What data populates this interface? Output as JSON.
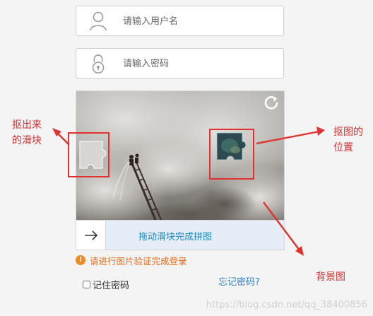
{
  "login": {
    "username_placeholder": "请输入用户名",
    "password_placeholder": "请输入密码"
  },
  "captcha": {
    "slider_text": "拖动滑块完成拼图",
    "hint_icon": "!",
    "hint": "请进行图片验证完成登录"
  },
  "form": {
    "remember_label": "记住密码",
    "forgot_link": "忘记密码?"
  },
  "annotations": {
    "slice_label_line1": "抠出来",
    "slice_label_line2": "的滑块",
    "position_label_line1": "抠图的",
    "position_label_line2": "位置",
    "background_label": "背景图"
  },
  "watermark": "https://blog.csdn.net/qq_38400856",
  "colors": {
    "annotation_red": "#e0332f",
    "link_blue": "#2f7fc4",
    "warning_orange": "#f08a24",
    "slider_bg": "#e5eef8"
  },
  "icons": {
    "username": "user-icon",
    "password": "lock-icon",
    "refresh": "refresh-icon",
    "slider_handle": "arrow-right-icon",
    "hint": "warning-icon"
  }
}
